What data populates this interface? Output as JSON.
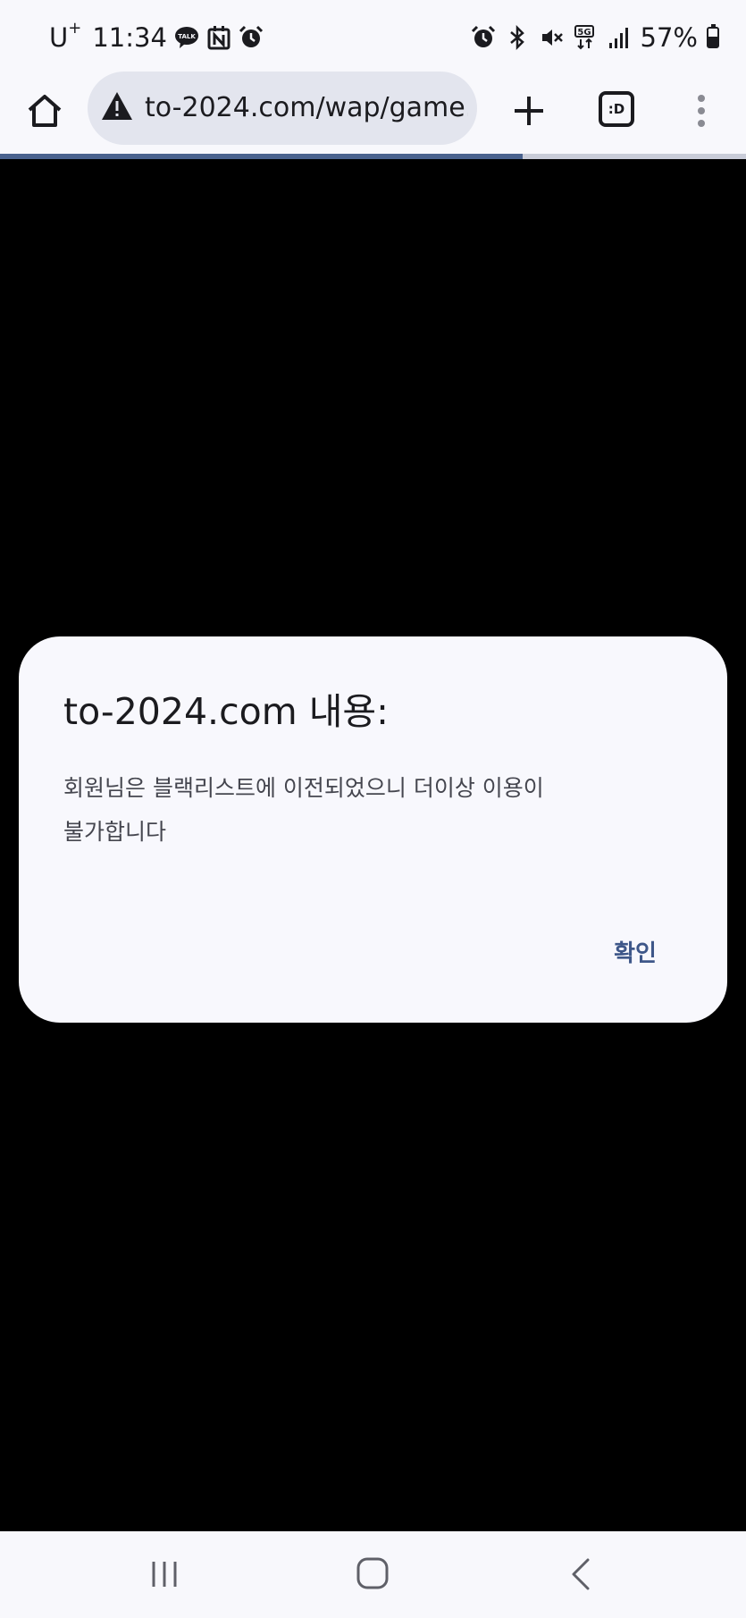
{
  "status_bar": {
    "carrier": "U",
    "carrier_sup": "+",
    "time": "11:34",
    "left_icons": [
      "kakaotalk-icon",
      "naver-calendar-icon",
      "alarm-icon"
    ],
    "right_icons": [
      "alarm-icon",
      "bluetooth-icon",
      "mute-icon",
      "5g-icon",
      "signal-icon"
    ],
    "battery_percent": "57%",
    "battery_level": 0.57
  },
  "browser": {
    "url": "to-2024.com/wap/game.",
    "tabs_label": ":D",
    "page_load_progress": 0.7,
    "colors": {
      "toolbar_bg": "#f8f8fc",
      "omnibox_bg": "#e3e5ee",
      "progress": "#4a628e"
    }
  },
  "dialog": {
    "title": "to-2024.com 내용:",
    "message_line1": "회원님은 블랙리스트에 이전되었으니 더이상 이용이",
    "message_line2": "불가합니다",
    "ok_label": "확인",
    "colors": {
      "background": "#f8f8fd",
      "accent": "#3e5789"
    }
  },
  "nav_bar": {
    "icons": [
      "recents-icon",
      "home-icon",
      "back-icon"
    ]
  }
}
